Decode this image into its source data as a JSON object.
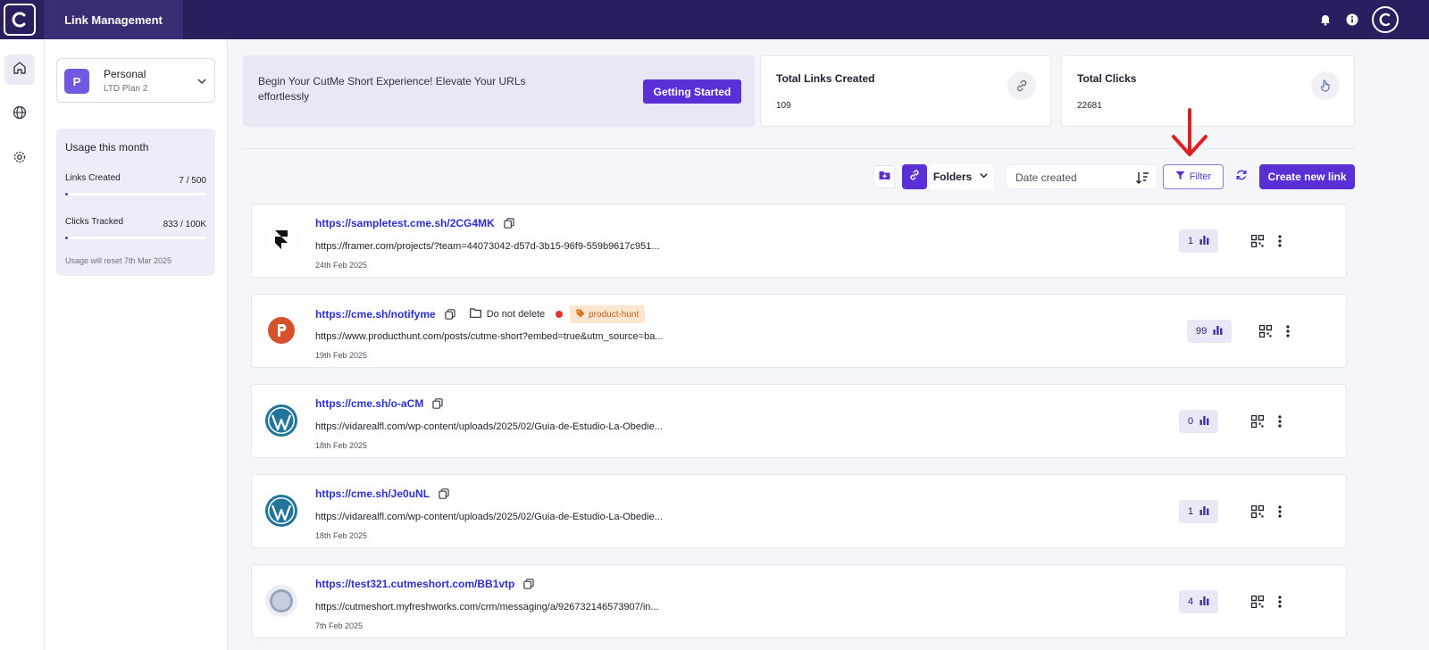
{
  "topbar": {
    "title": "Link Management",
    "icons": [
      "bell-icon",
      "info-icon"
    ],
    "avatar": "user-avatar"
  },
  "rail": {
    "items": [
      {
        "name": "home-icon",
        "active": true
      },
      {
        "name": "globe-icon",
        "active": false
      },
      {
        "name": "gear-icon",
        "active": false
      }
    ]
  },
  "workspace": {
    "badge": "P",
    "name": "Personal",
    "plan": "LTD Plan 2"
  },
  "usage": {
    "title": "Usage this month",
    "links_label": "Links Created",
    "links_value": "7 / 500",
    "links_fraction": 0.014,
    "clicks_label": "Clicks Tracked",
    "clicks_value": "833 / 100K",
    "clicks_fraction": 0.008,
    "reset": "Usage will reset 7th Mar 2025"
  },
  "banner": {
    "text": "Begin Your CutMe Short Experience! Elevate Your URLs effortlessly",
    "button": "Getting Started"
  },
  "stats": {
    "links_label": "Total Links Created",
    "links_value": "109",
    "clicks_label": "Total Clicks",
    "clicks_value": "22681"
  },
  "toolbar": {
    "folders": "Folders",
    "sort": "Date created",
    "filter": "Filter",
    "create": "Create new link"
  },
  "links": [
    {
      "short": "https://sampletest.cme.sh/2CG4MK",
      "long": "https://framer.com/projects/?team=44073042-d57d-3b15-96f9-559b9617c951...",
      "date": "24th Feb 2025",
      "clicks": "1",
      "logo": "framer-logo"
    },
    {
      "short": "https://cme.sh/notifyme",
      "long": "https://www.producthunt.com/posts/cutme-short?embed=true&utm_source=ba...",
      "date": "19th Feb 2025",
      "clicks": "99",
      "logo": "producthunt-logo",
      "folder": "Do not delete",
      "tag": "product-hunt"
    },
    {
      "short": "https://cme.sh/o-aCM",
      "long": "https://vidarealfl.com/wp-content/uploads/2025/02/Guia-de-Estudio-La-Obedie...",
      "date": "18th Feb 2025",
      "clicks": "0",
      "logo": "wordpress-logo"
    },
    {
      "short": "https://cme.sh/Je0uNL",
      "long": "https://vidarealfl.com/wp-content/uploads/2025/02/Guia-de-Estudio-La-Obedie...",
      "date": "18th Feb 2025",
      "clicks": "1",
      "logo": "wordpress-logo"
    },
    {
      "short": "https://test321.cutmeshort.com/BB1vtp",
      "long": "https://cutmeshort.myfreshworks.com/crm/messaging/a/926732146573907/in...",
      "date": "7th Feb 2025",
      "clicks": "4",
      "logo": "globe-logo"
    }
  ],
  "colors": {
    "topbar": "#2b1e5e",
    "accent": "#5a2fd6",
    "short_link": "#2a2fd6",
    "annotation_arrow": "#e02020"
  }
}
